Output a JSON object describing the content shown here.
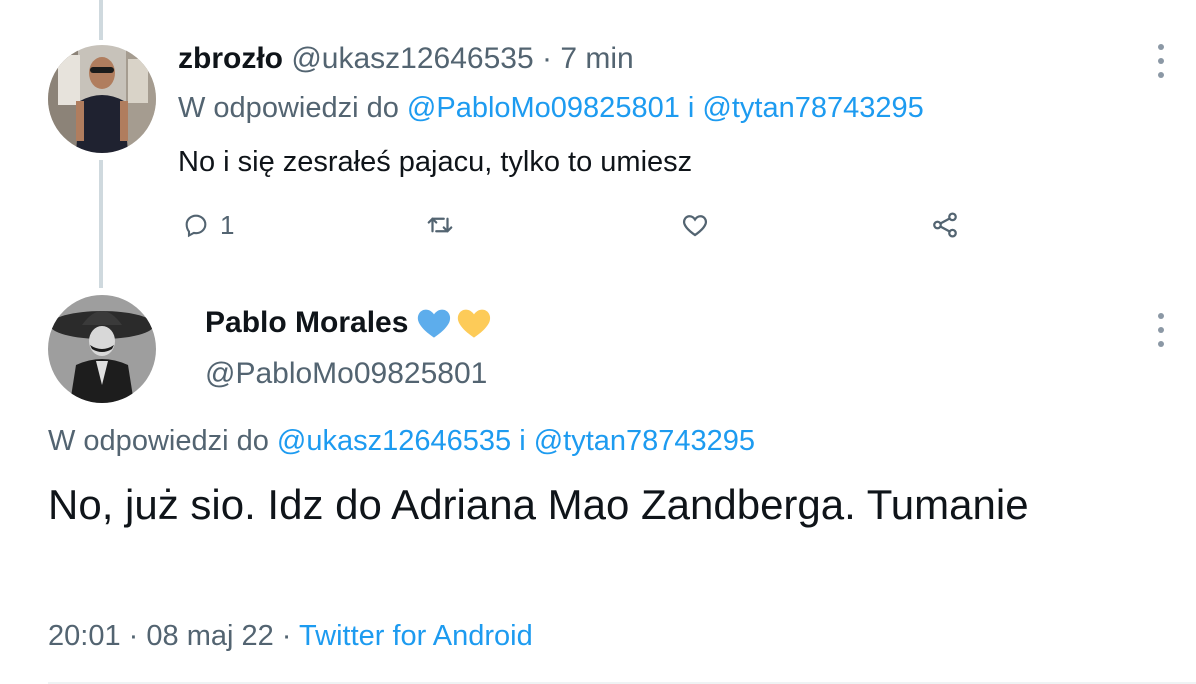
{
  "reply_tweet": {
    "display_name": "zbrozło",
    "handle": "@ukasz12646535",
    "separator": "·",
    "time": "7 min",
    "context_prefix": "W odpowiedzi do",
    "context_user1": "@PabloMo09825801",
    "context_joiner": "i",
    "context_user2": "@tytan78743295",
    "text": "No i się zesrałeś pajacu, tylko to umiesz",
    "reply_count": "1",
    "icons": {
      "reply": "reply-icon",
      "retweet": "retweet-icon",
      "like": "like-icon",
      "share": "share-icon",
      "more": "more-icon"
    }
  },
  "main_tweet": {
    "display_name": "Pablo Morales",
    "name_emoji": [
      "blue-heart",
      "yellow-heart"
    ],
    "handle": "@PabloMo09825801",
    "context_prefix": "W odpowiedzi do",
    "context_user1": "@ukasz12646535",
    "context_joiner": "i",
    "context_user2": "@tytan78743295",
    "text": "No, już sio. Idz do Adriana Mao Zandberga. Tumanie",
    "time": "20:01",
    "sep1": "·",
    "date": "08 maj 22",
    "sep2": "·",
    "source": "Twitter for Android"
  },
  "colors": {
    "link": "#1d9bf0",
    "muted": "#536471",
    "text": "#0f1419",
    "thread_line": "#cfd9de",
    "heart_blue": "#5dadec",
    "heart_yellow": "#fdcb58"
  }
}
